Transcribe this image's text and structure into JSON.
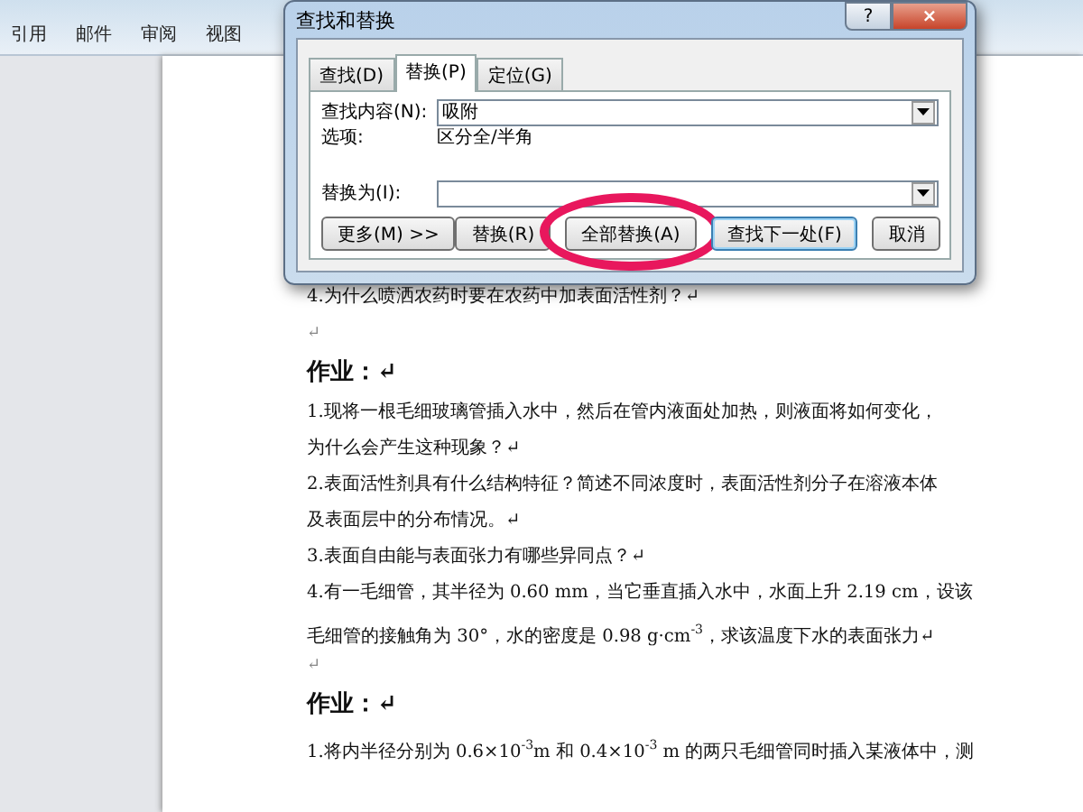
{
  "ribbon": {
    "tabs": [
      {
        "label": "引用",
        "selected": false
      },
      {
        "label": "邮件",
        "selected": false
      },
      {
        "label": "审阅",
        "selected": false
      },
      {
        "label": "视图",
        "selected": false
      }
    ]
  },
  "document": {
    "paragraphs": [
      {
        "kind": "text",
        "text": "4.为什么喷洒农药时要在农药中加表面活性剂？↵"
      },
      {
        "kind": "mark",
        "text": "↵"
      },
      {
        "kind": "heading",
        "text": "作业：↵"
      },
      {
        "kind": "text",
        "text": "1.现将一根毛细玻璃管插入水中，然后在管内液面处加热，则液面将如何变化，"
      },
      {
        "kind": "text",
        "text": "为什么会产生这种现象？↵"
      },
      {
        "kind": "text",
        "text": "2.表面活性剂具有什么结构特征？简述不同浓度时，表面活性剂分子在溶液本体"
      },
      {
        "kind": "text",
        "text": "及表面层中的分布情况。↵"
      },
      {
        "kind": "text",
        "text": "3.表面自由能与表面张力有哪些异同点？↵"
      },
      {
        "kind": "text",
        "text": "4.有一毛细管，其半径为 0.60 mm，当它垂直插入水中，水面上升 2.19 cm，设该"
      },
      {
        "kind": "text",
        "text": "毛细管的接触角为 30°，水的密度是 0.98 g·cm$^{-3}$，求该温度下水的表面张力↵"
      },
      {
        "kind": "mark",
        "text": "↵"
      },
      {
        "kind": "heading",
        "text": "作业：↵"
      },
      {
        "kind": "text",
        "text": "1.将内半径分别为 0.6×10$^{-3}$m 和 0.4×10$^{-3}$ m 的两只毛细管同时插入某液体中，测"
      }
    ]
  },
  "dialog": {
    "title": "查找和替换",
    "help": "?",
    "close": "×",
    "tabs": [
      {
        "label": "查找(D)",
        "selected": false
      },
      {
        "label": "替换(P)",
        "selected": true
      },
      {
        "label": "定位(G)",
        "selected": false
      }
    ],
    "find_label": "查找内容(N):",
    "find_value": "吸附",
    "options_label": "选项:",
    "options_value": "区分全/半角",
    "replace_label": "替换为(I):",
    "buttons": [
      {
        "label": "更多(M) >>",
        "kind": "left",
        "highlighted": false,
        "default": false
      },
      {
        "label": "替换(R)",
        "kind": "right",
        "highlighted": false,
        "default": false
      },
      {
        "label": "全部替换(A)",
        "kind": "right",
        "highlighted": true,
        "default": false
      },
      {
        "label": "查找下一处(F)",
        "kind": "right",
        "highlighted": false,
        "default": true
      },
      {
        "label": "取消",
        "kind": "right",
        "highlighted": false,
        "default": false
      }
    ]
  }
}
